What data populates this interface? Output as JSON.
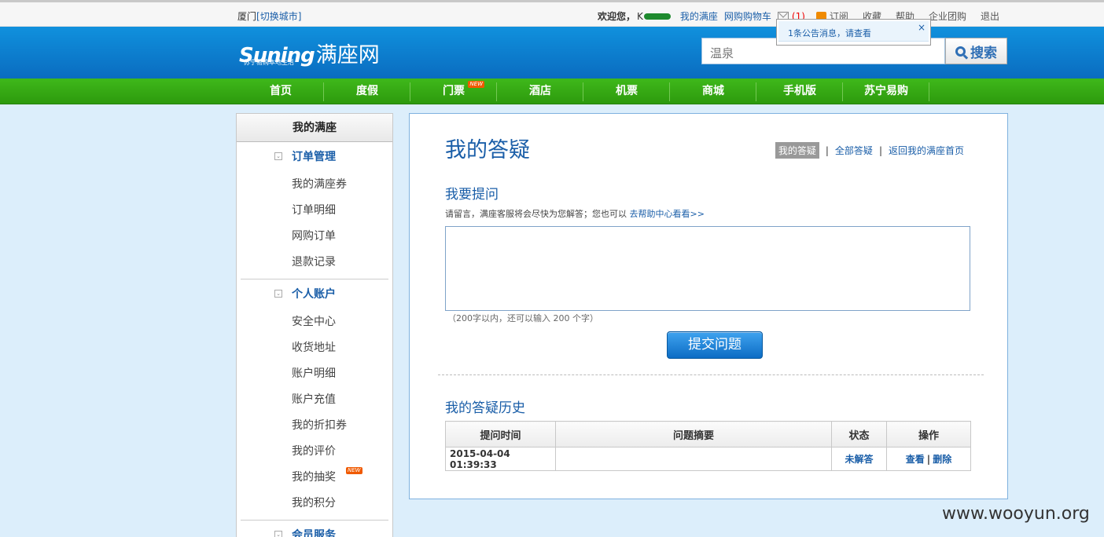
{
  "topbar": {
    "city": "厦门",
    "switch_city": "[切换城市]",
    "welcome": "欢迎您，",
    "username": "K",
    "links": [
      "我的满座",
      "网购购物车"
    ],
    "msg_count": "(1)",
    "subscribe": "订阅",
    "right_links": [
      "收藏",
      "帮助",
      "企业团购",
      "退出"
    ]
  },
  "notice": {
    "text": "1条公告消息，请查看",
    "close": "×"
  },
  "header": {
    "logo_en": "Suning",
    "logo_cn": "满座网",
    "logo_sub": "苏宁易购本地生活",
    "search_placeholder": "温泉",
    "search_button": "搜索"
  },
  "nav": {
    "items": [
      "首页",
      "度假",
      "门票",
      "酒店",
      "机票",
      "商城",
      "手机版",
      "苏宁易购"
    ],
    "new_badge": "NEW"
  },
  "sidebar": {
    "title": "我的满座",
    "sections": [
      {
        "title": "订单管理",
        "items": [
          "我的满座券",
          "订单明细",
          "网购订单",
          "退款记录"
        ]
      },
      {
        "title": "个人账户",
        "items": [
          "安全中心",
          "收货地址",
          "账户明细",
          "账户充值",
          "我的折扣券",
          "我的评价",
          "我的抽奖",
          "我的积分"
        ]
      },
      {
        "title": "会员服务",
        "items": []
      }
    ],
    "toggle_glyph": "⌄"
  },
  "main": {
    "title": "我的答疑",
    "tabs": {
      "active": "我的答疑",
      "all": "全部答疑",
      "back": "返回我的满座首页"
    },
    "ask_title": "我要提问",
    "hint": "请留言，满座客服将会尽快为您解答；您也可以",
    "hint_link": "去帮助中心看看>>",
    "question_value": "",
    "limit_text": "（200字以内，还可以输入 200 个字）",
    "submit": "提交问题",
    "history_title": "我的答疑历史",
    "table": {
      "headers": [
        "提问时间",
        "问题摘要",
        "状态",
        "操作"
      ],
      "rows": [
        {
          "time": "2015-04-04 01:39:33",
          "summary": "",
          "status": "未解答",
          "view": "查看",
          "delete": "删除"
        }
      ]
    }
  },
  "watermark": "www.wooyun.org",
  "colors": {
    "link": "#1a5ea8",
    "header_blue": "#0a7ccb",
    "nav_green": "#36a814",
    "page_bg": "#dceefb"
  }
}
